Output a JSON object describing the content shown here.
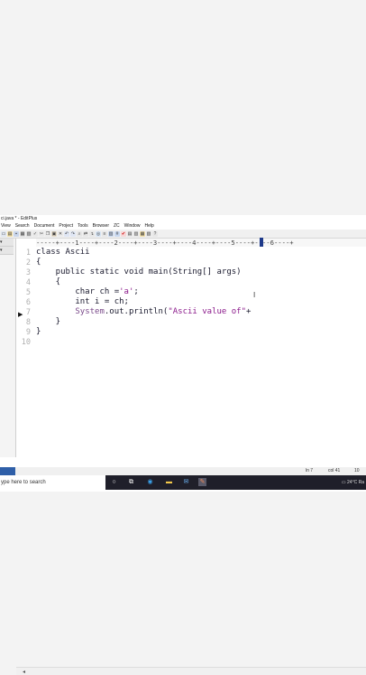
{
  "window": {
    "title": "ci.java * - EditPlus"
  },
  "menu": [
    "View",
    "Search",
    "Document",
    "Project",
    "Tools",
    "Browser",
    "ZC",
    "Window",
    "Help"
  ],
  "ruler": {
    "text": "-----+----1----+----2----+----3----+----4----+----5----+----6----+"
  },
  "editor": {
    "line_numbers": [
      "1",
      "2",
      "3",
      "4",
      "5",
      "6",
      "7",
      "8",
      "9",
      "10"
    ],
    "lines": [
      "class Ascii",
      "{",
      "    public static void main(String[] args)",
      "    {",
      "        char ch ='a';",
      "        int i = ch;",
      "        System.out.println(\"Ascii value of\"+",
      "    }",
      "}",
      ""
    ],
    "line5_code": "        char ch =",
    "line5_string": "'a'",
    "line5_end": ";",
    "line7_indent": "        ",
    "line7_obj": "System",
    "line7_mid": ".out.println(",
    "line7_string": "\"Ascii value of\"",
    "line7_end": "+"
  },
  "status": {
    "line": "ln 7",
    "col": "col 41",
    "extra": "10"
  },
  "taskbar": {
    "search_placeholder": "ype here to search",
    "weather": "24°C",
    "tray_text": "Ra"
  }
}
